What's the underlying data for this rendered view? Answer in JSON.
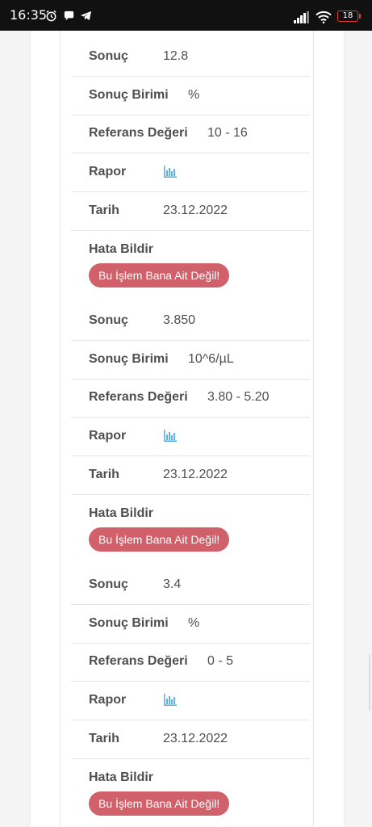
{
  "status_bar": {
    "time": "16:35",
    "battery": "18"
  },
  "labels": {
    "result": "Sonuç",
    "unit": "Sonuç Birimi",
    "reference": "Referans Değeri",
    "report": "Rapor",
    "date": "Tarih",
    "report_error": "Hata Bildir",
    "not_mine_button": "Bu İşlem Bana Ait Değil!"
  },
  "records": [
    {
      "result": "12.8",
      "unit": "%",
      "reference": "10 - 16",
      "date": "23.12.2022"
    },
    {
      "result": "3.850",
      "unit": "10^6/µL",
      "reference": "3.80 - 5.20",
      "date": "23.12.2022"
    },
    {
      "result": "3.4",
      "unit": "%",
      "reference": "0 - 5",
      "date": "23.12.2022"
    }
  ],
  "colors": {
    "button": "#d0606a",
    "chart_icon": "#5ab4e6",
    "text": "#4f4f4f"
  },
  "icons": {
    "report": "bar-chart-icon"
  }
}
